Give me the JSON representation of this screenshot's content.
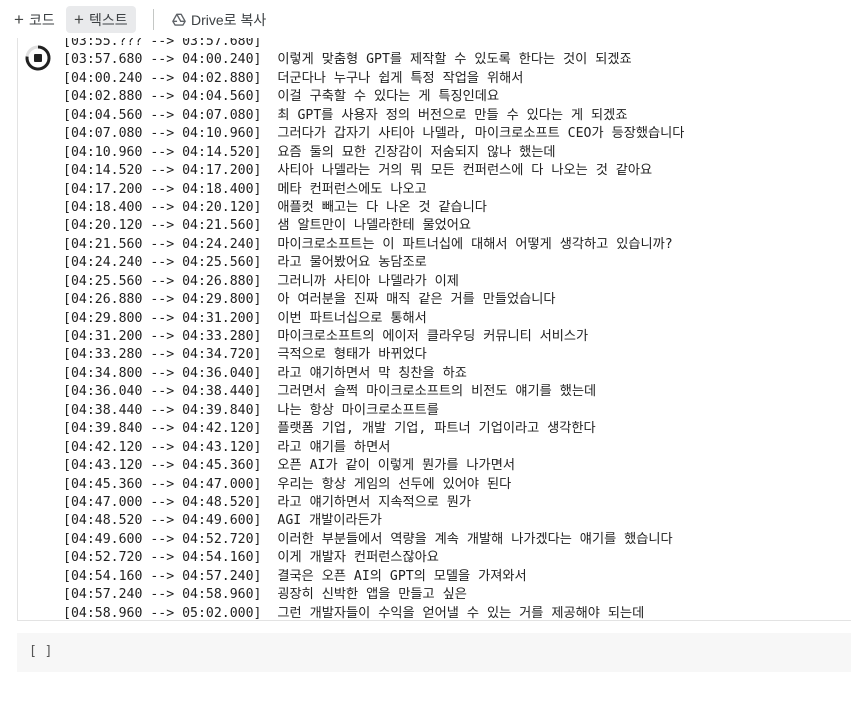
{
  "toolbar": {
    "code_label": "코드",
    "text_label": "텍스트",
    "drive_label": "Drive로 복사",
    "icons": [
      "plus-icon",
      "google-drive-icon"
    ]
  },
  "cell": {
    "run_icon": "stop-icon",
    "lines": [
      {
        "ts": "[03:55.??? --> 03:57.680]",
        "text": ""
      },
      {
        "ts": "[03:57.680 --> 04:00.240]",
        "text": "이렇게 맞춤형 GPT를 제작할 수 있도록 한다는 것이 되겠죠"
      },
      {
        "ts": "[04:00.240 --> 04:02.880]",
        "text": "더군다나 누구나 쉽게 특정 작업을 위해서"
      },
      {
        "ts": "[04:02.880 --> 04:04.560]",
        "text": "이걸 구축할 수 있다는 게 특징인데요"
      },
      {
        "ts": "[04:04.560 --> 04:07.080]",
        "text": "최 GPT를 사용자 정의 버전으로 만들 수 있다는 게 되겠죠"
      },
      {
        "ts": "[04:07.080 --> 04:10.960]",
        "text": "그러다가 갑자기 사티아 나델라, 마이크로소프트 CEO가 등장했습니다"
      },
      {
        "ts": "[04:10.960 --> 04:14.520]",
        "text": "요즘 둘의 묘한 긴장감이 저숨되지 않나 했는데"
      },
      {
        "ts": "[04:14.520 --> 04:17.200]",
        "text": "사티아 나델라는 거의 뭐 모든 컨퍼런스에 다 나오는 것 같아요"
      },
      {
        "ts": "[04:17.200 --> 04:18.400]",
        "text": "메타 컨퍼런스에도 나오고"
      },
      {
        "ts": "[04:18.400 --> 04:20.120]",
        "text": "애플컷 빼고는 다 나온 것 같습니다"
      },
      {
        "ts": "[04:20.120 --> 04:21.560]",
        "text": "샘 알트만이 나델라한테 물었어요"
      },
      {
        "ts": "[04:21.560 --> 04:24.240]",
        "text": "마이크로소프트는 이 파트너십에 대해서 어떻게 생각하고 있습니까?"
      },
      {
        "ts": "[04:24.240 --> 04:25.560]",
        "text": "라고 물어봤어요 농담조로"
      },
      {
        "ts": "[04:25.560 --> 04:26.880]",
        "text": "그러니까 사티아 나델라가 이제"
      },
      {
        "ts": "[04:26.880 --> 04:29.800]",
        "text": "아 여러분을 진짜 매직 같은 거를 만들었습니다"
      },
      {
        "ts": "[04:29.800 --> 04:31.200]",
        "text": "이번 파트너십으로 통해서"
      },
      {
        "ts": "[04:31.200 --> 04:33.280]",
        "text": "마이크로소프트의 에이저 클라우딩 커뮤니티 서비스가"
      },
      {
        "ts": "[04:33.280 --> 04:34.720]",
        "text": "극적으로 형태가 바뀌었다"
      },
      {
        "ts": "[04:34.800 --> 04:36.040]",
        "text": "라고 얘기하면서 막 칭찬을 하죠"
      },
      {
        "ts": "[04:36.040 --> 04:38.440]",
        "text": "그러면서 슬쩍 마이크로소프트의 비전도 얘기를 했는데"
      },
      {
        "ts": "[04:38.440 --> 04:39.840]",
        "text": "나는 항상 마이크로소프트를"
      },
      {
        "ts": "[04:39.840 --> 04:42.120]",
        "text": "플랫폼 기업, 개발 기업, 파트너 기업이라고 생각한다"
      },
      {
        "ts": "[04:42.120 --> 04:43.120]",
        "text": "라고 얘기를 하면서"
      },
      {
        "ts": "[04:43.120 --> 04:45.360]",
        "text": "오픈 AI가 같이 이렇게 뭔가를 나가면서"
      },
      {
        "ts": "[04:45.360 --> 04:47.000]",
        "text": "우리는 항상 게임의 선두에 있어야 된다"
      },
      {
        "ts": "[04:47.000 --> 04:48.520]",
        "text": "라고 얘기하면서 지속적으로 뭔가"
      },
      {
        "ts": "[04:48.520 --> 04:49.600]",
        "text": "AGI 개발이라든가"
      },
      {
        "ts": "[04:49.600 --> 04:52.720]",
        "text": "이러한 부분들에서 역량을 계속 개발해 나가겠다는 얘기를 했습니다"
      },
      {
        "ts": "[04:52.720 --> 04:54.160]",
        "text": "이게 개발자 컨퍼런스잖아요"
      },
      {
        "ts": "[04:54.160 --> 04:57.240]",
        "text": "결국은 오픈 AI의 GPT의 모델을 가져와서"
      },
      {
        "ts": "[04:57.240 --> 04:58.960]",
        "text": "굉장히 신박한 앱을 만들고 싶은"
      },
      {
        "ts": "[04:58.960 --> 05:02.000]",
        "text": "그런 개발자들이 수익을 얻어낼 수 있는 거를 제공해야 되는데"
      }
    ]
  },
  "empty_cell": {
    "placeholder": "[ ]"
  }
}
